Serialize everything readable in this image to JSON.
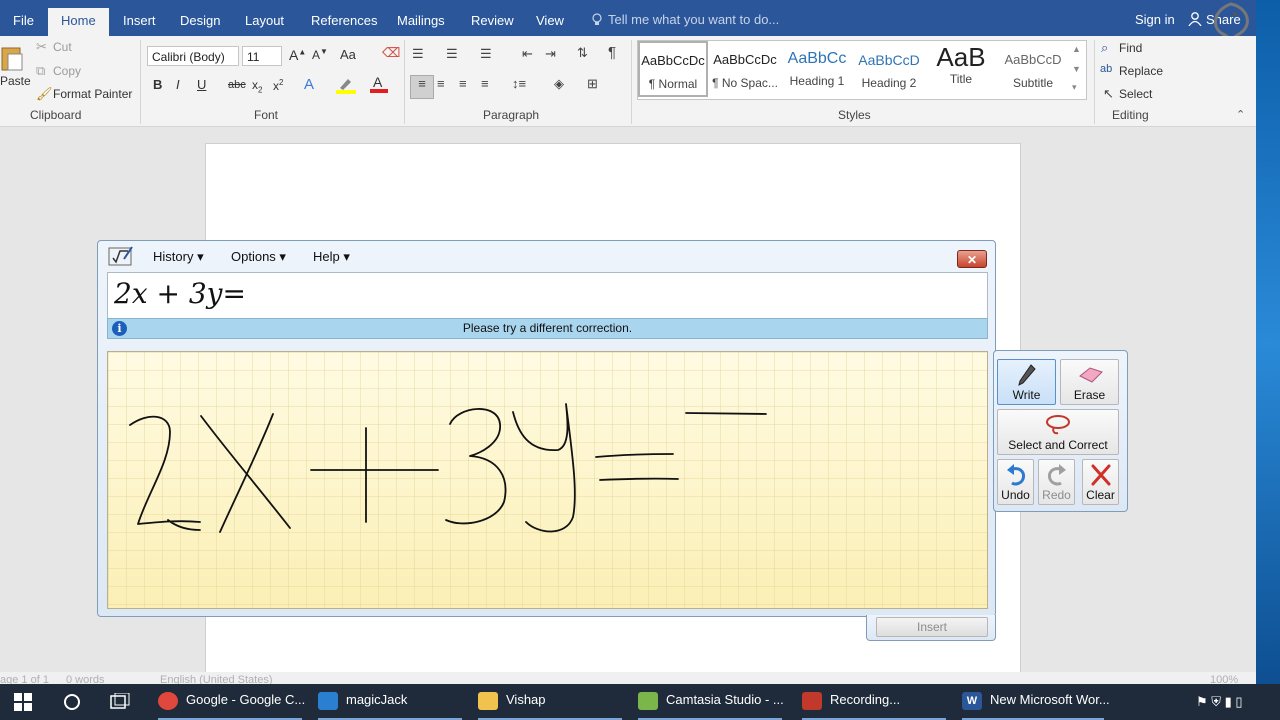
{
  "tabs": {
    "file": "File",
    "home": "Home",
    "insert": "Insert",
    "design": "Design",
    "layout": "Layout",
    "references": "References",
    "mailings": "Mailings",
    "review": "Review",
    "view": "View",
    "tell_me": "Tell me what you want to do...",
    "sign_in": "Sign in",
    "share": "Share"
  },
  "clipboard": {
    "paste": "Paste",
    "cut": "Cut",
    "copy": "Copy",
    "format_painter": "Format Painter",
    "label": "Clipboard"
  },
  "font": {
    "name": "Calibri (Body)",
    "size": "11",
    "case": "Aa",
    "label": "Font"
  },
  "paragraph": {
    "label": "Paragraph"
  },
  "styles": {
    "label": "Styles",
    "items": [
      {
        "preview": "AaBbCcDc",
        "name": "¶ Normal"
      },
      {
        "preview": "AaBbCcDc",
        "name": "¶ No Spac..."
      },
      {
        "preview": "AaBbCc",
        "name": "Heading 1"
      },
      {
        "preview": "AaBbCcD",
        "name": "Heading 2"
      },
      {
        "preview": "AaB",
        "name": "Title"
      },
      {
        "preview": "AaBbCcD",
        "name": "Subtitle"
      }
    ]
  },
  "editing": {
    "find": "Find",
    "replace": "Replace",
    "select": "Select",
    "label": "Editing"
  },
  "status": {
    "page": "age 1 of 1",
    "words": "0 words",
    "lang": "English (United States)",
    "zoom": "100%"
  },
  "math_panel": {
    "menu": {
      "history": "History",
      "options": "Options",
      "help": "Help"
    },
    "preview_text": "2x + 3y=",
    "info_message": "Please try a different correction.",
    "tools": {
      "write": "Write",
      "erase": "Erase",
      "select_correct": "Select and Correct",
      "undo": "Undo",
      "redo": "Redo",
      "clear": "Clear"
    },
    "insert": "Insert"
  },
  "taskbar": {
    "items": [
      {
        "label": "Google - Google C...",
        "color": "#e0483e"
      },
      {
        "label": "magicJack",
        "color": "#2a7fd0"
      },
      {
        "label": "Vishap",
        "color": "#f2c24e"
      },
      {
        "label": "Camtasia Studio - ...",
        "color": "#7bb64a"
      },
      {
        "label": "Recording...",
        "color": "#c0392b"
      },
      {
        "label": "New Microsoft Wor...",
        "color": "#2b579a"
      }
    ]
  },
  "colors": {
    "word_blue": "#2b579a",
    "ink": "#111111",
    "canvas": "#fdf6cc"
  }
}
